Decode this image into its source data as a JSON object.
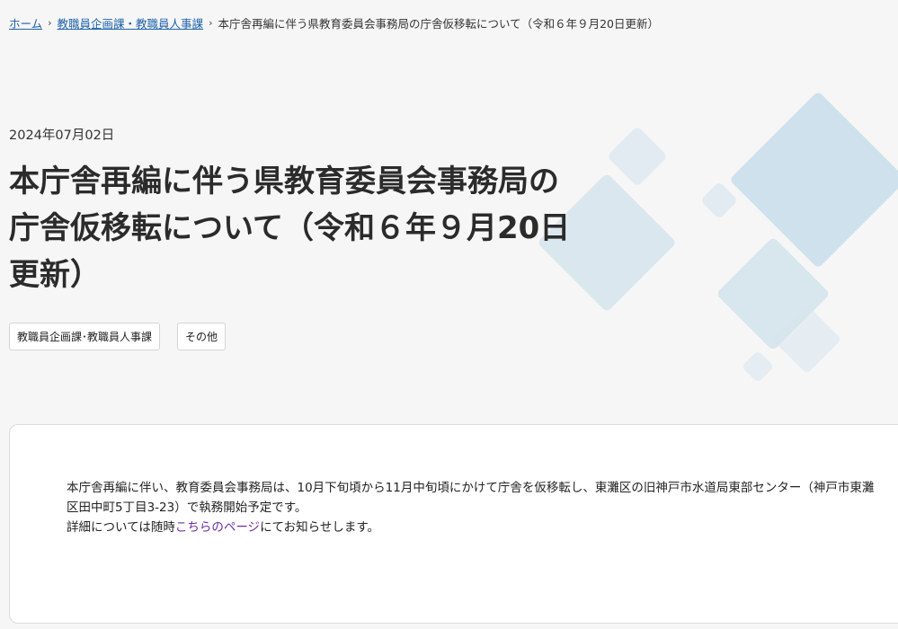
{
  "breadcrumb": {
    "home": "ホーム",
    "section": "教職員企画課・教職員人事課",
    "current": "本庁舎再編に伴う県教育委員会事務局の庁舎仮移転について（令和６年９月20日更新）",
    "separator": "›"
  },
  "article": {
    "date": "2024年07月02日",
    "title_line1": "本庁舎再編に伴う県教育委員会事務局の",
    "title_line2": "庁舎仮移転について（令和６年９月20日",
    "title_line3": "更新）",
    "tags": [
      "教職員企画課･教職員人事課",
      "その他"
    ]
  },
  "content": {
    "paragraph1": "本庁舎再編に伴い、教育委員会事務局は、10月下旬頃から11月中旬頃にかけて庁舎を仮移転し、東灘区の旧神戸市水道局東部センター（神戸市東灘区田中町5丁目3-23）で執務開始予定です。",
    "paragraph2_prefix": "詳細については随時",
    "paragraph2_link": "こちらのページ",
    "paragraph2_suffix": "にてお知らせします。"
  },
  "colors": {
    "link": "#1d62a8",
    "visited_link": "#6b2fa3",
    "background": "#f6f6f7",
    "decoration": "#c7dce8"
  }
}
